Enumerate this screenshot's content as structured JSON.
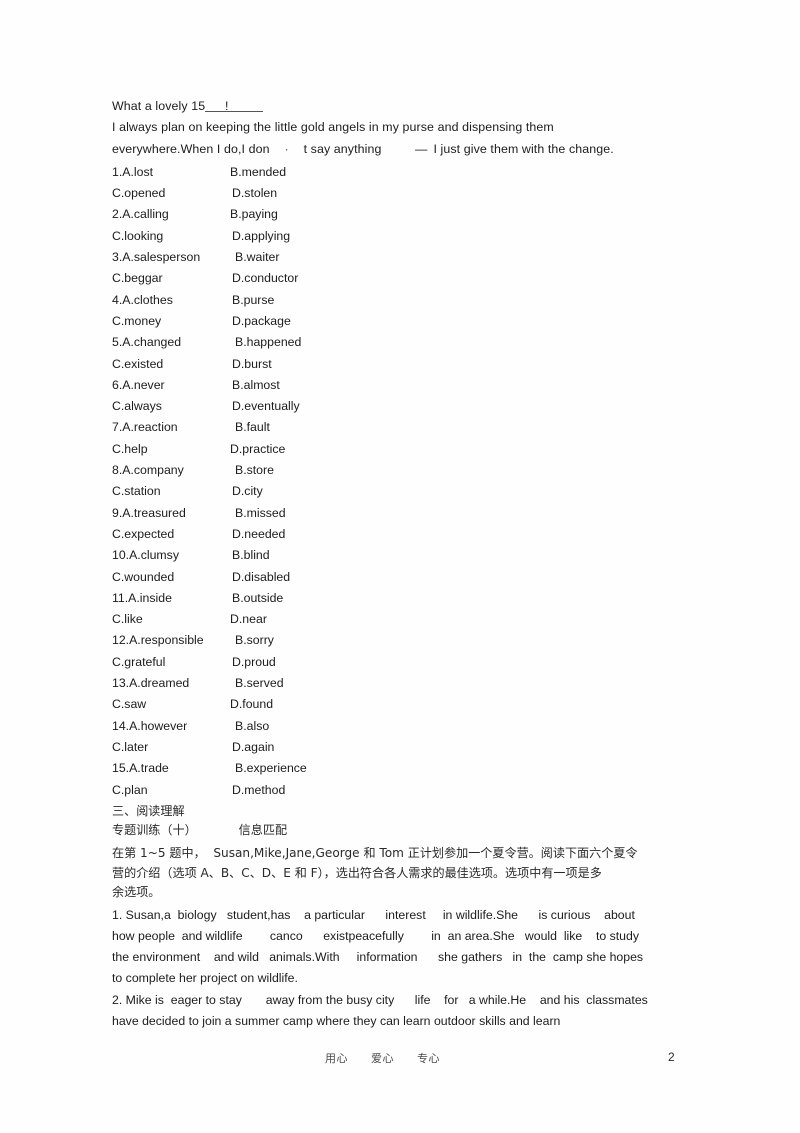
{
  "document": {
    "intro": {
      "line1_prefix": "What a lovely 15",
      "line1_mark": "!",
      "line2": "I always plan on keeping the little gold angels in my purse and dispensing them",
      "line3_a": "everywhere.When I do,I don",
      "line3_apostrophe": "·",
      "line3_b": "t say anything",
      "line3_dash": "—",
      "line3_c": "I just give them with the change."
    },
    "cloze_options": [
      {
        "a": "1.A.lost",
        "b": "B.mended",
        "indent": 0
      },
      {
        "a": "C.opened",
        "b": "D.stolen",
        "indent": 1
      },
      {
        "a": "2.A.calling",
        "b": "B.paying",
        "indent": 0
      },
      {
        "a": "C.looking",
        "b": "D.applying",
        "indent": 1
      },
      {
        "a": "3.A.salesperson",
        "b": "B.waiter",
        "indent": 2
      },
      {
        "a": "C.beggar",
        "b": "D.conductor",
        "indent": 1
      },
      {
        "a": "4.A.clothes",
        "b": "B.purse",
        "indent": 1
      },
      {
        "a": "C.money",
        "b": "D.package",
        "indent": 1
      },
      {
        "a": "5.A.changed",
        "b": "B.happened",
        "indent": 2
      },
      {
        "a": "C.existed",
        "b": "D.burst",
        "indent": 1
      },
      {
        "a": "6.A.never",
        "b": "B.almost",
        "indent": 1
      },
      {
        "a": "C.always",
        "b": "D.eventually",
        "indent": 1
      },
      {
        "a": "7.A.reaction",
        "b": "B.fault",
        "indent": 2
      },
      {
        "a": "C.help",
        "b": "D.practice",
        "indent": 0
      },
      {
        "a": "8.A.company",
        "b": "B.store",
        "indent": 2
      },
      {
        "a": "C.station",
        "b": "D.city",
        "indent": 1
      },
      {
        "a": "9.A.treasured",
        "b": "B.missed",
        "indent": 2
      },
      {
        "a": "C.expected",
        "b": "D.needed",
        "indent": 1
      },
      {
        "a": "10.A.clumsy",
        "b": "B.blind",
        "indent": 1
      },
      {
        "a": "C.wounded",
        "b": "D.disabled",
        "indent": 1
      },
      {
        "a": "11.A.inside",
        "b": "B.outside",
        "indent": 1
      },
      {
        "a": "C.like",
        "b": "D.near",
        "indent": 0
      },
      {
        "a": "12.A.responsible",
        "b": "B.sorry",
        "indent": 2
      },
      {
        "a": "C.grateful",
        "b": "D.proud",
        "indent": 1
      },
      {
        "a": "13.A.dreamed",
        "b": "B.served",
        "indent": 2
      },
      {
        "a": "C.saw",
        "b": "D.found",
        "indent": 0
      },
      {
        "a": "14.A.however",
        "b": "B.also",
        "indent": 2
      },
      {
        "a": "C.later",
        "b": "D.again",
        "indent": 1
      },
      {
        "a": "15.A.trade",
        "b": "B.experience",
        "indent": 2
      },
      {
        "a": "C.plan",
        "b": "D.method",
        "indent": 1
      }
    ],
    "reading": {
      "section_heading": "三、阅读理解",
      "topic_label": "专题训练（十）",
      "topic_name": "信息匹配",
      "instruction_line1": "在第 1~5 题中，  Susan,Mike,Jane,George 和 Tom 正计划参加一个夏令营。阅读下面六个夏令",
      "instruction_line2": "营的介绍（选项 A、B、C、D、E 和 F），选出符合各人需求的最佳选项。选项中有一项是多",
      "instruction_line3": "余选项。",
      "items": [
        {
          "lines": [
            "1. Susan,a  biology   student,has    a particular      interest     in wildlife.She      is curious    about",
            "how people  and wildlife        canco      existpeacefully        in  an area.She   would  like    to study",
            "the environment    and wild   animals.With     information      she gathers   in  the  camp she hopes",
            "to complete her project on wildlife."
          ]
        },
        {
          "lines": [
            "2. Mike is  eager to stay       away from the busy city      life    for   a while.He    and his  classmates",
            "have decided to join a summer camp where they can learn outdoor skills and learn"
          ]
        }
      ]
    },
    "footer": {
      "motto": "用心　　爱心　　专心",
      "page_number": "2"
    }
  }
}
